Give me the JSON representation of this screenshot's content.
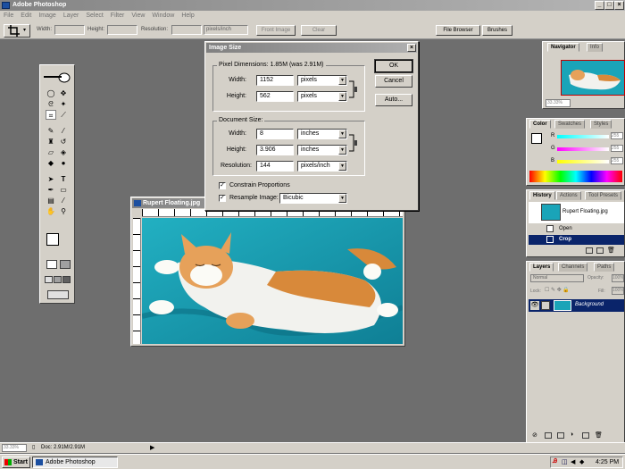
{
  "app": {
    "title": "Adobe Photoshop"
  },
  "menu": [
    "File",
    "Edit",
    "Image",
    "Layer",
    "Select",
    "Filter",
    "View",
    "Window",
    "Help"
  ],
  "options_bar": {
    "width_label": "Width:",
    "height_label": "Height:",
    "resolution_label": "Resolution:",
    "resolution_unit": "pixels/inch",
    "front_image": "Front Image",
    "clear": "Clear",
    "file_browser": "File Browser",
    "brushes": "Brushes"
  },
  "image_window": {
    "title": "Rupert Floating.jpg"
  },
  "dialog": {
    "title": "Image Size",
    "pixel_dimensions_label": "Pixel Dimensions: 1.85M (was 2.91M)",
    "pixel_width_label": "Width:",
    "pixel_width_value": "1152",
    "pixel_width_unit": "pixels",
    "pixel_height_label": "Height:",
    "pixel_height_value": "562",
    "pixel_height_unit": "pixels",
    "document_size_label": "Document Size:",
    "doc_width_label": "Width:",
    "doc_width_value": "8",
    "doc_width_unit": "inches",
    "doc_height_label": "Height:",
    "doc_height_value": "3.906",
    "doc_height_unit": "inches",
    "resolution_label": "Resolution:",
    "resolution_value": "144",
    "resolution_unit": "pixels/inch",
    "constrain_label": "Constrain Proportions",
    "resample_label": "Resample Image:",
    "resample_value": "Bicubic",
    "ok": "OK",
    "cancel": "Cancel",
    "auto": "Auto..."
  },
  "navigator": {
    "tab_navigator": "Navigator",
    "tab_info": "Info",
    "zoom": "33.33%"
  },
  "color_palette": {
    "tab_color": "Color",
    "tab_swatches": "Swatches",
    "tab_styles": "Styles",
    "r_label": "R",
    "g_label": "G",
    "b_label": "B",
    "r_value": "255",
    "g_value": "255",
    "b_value": "255"
  },
  "history": {
    "tab_history": "History",
    "tab_actions": "Actions",
    "tab_tool_presets": "Tool Presets",
    "snapshot": "Rupert Floating.jpg",
    "items": [
      "Open",
      "Crop"
    ]
  },
  "layers": {
    "tab_layers": "Layers",
    "tab_channels": "Channels",
    "tab_paths": "Paths",
    "blend_mode": "Normal",
    "opacity_label": "Opacity:",
    "opacity_value": "100%",
    "lock_label": "Lock:",
    "fill_label": "Fill:",
    "fill_value": "100%",
    "layer_name": "Background"
  },
  "status": {
    "zoom": "33.33%",
    "doc": "Doc: 2.91M/2.91M"
  },
  "taskbar": {
    "start": "Start",
    "app": "Adobe Photoshop",
    "time": "4:25 PM"
  },
  "colors": {
    "selection": "#0a246a",
    "title_gradient": "#848484",
    "photo_bg": "#1aa4b8"
  }
}
